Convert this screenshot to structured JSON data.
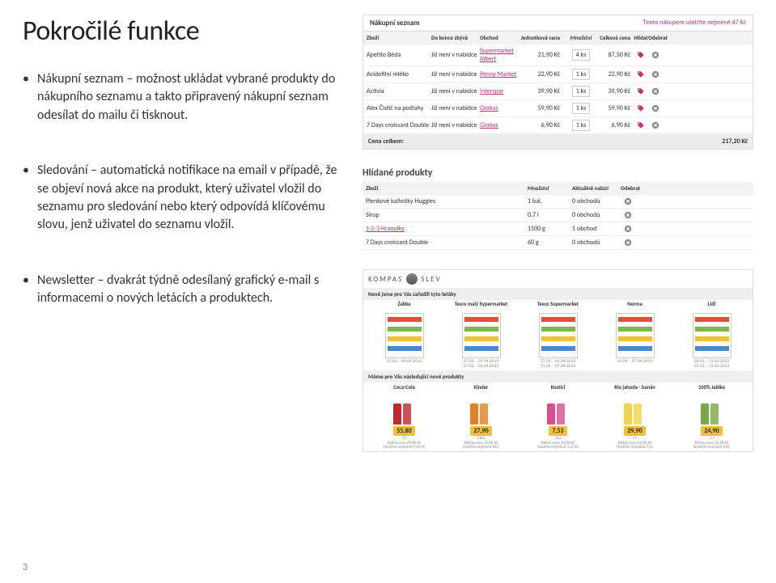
{
  "title": "Pokročilé funkce",
  "page_number": "3",
  "bullets": {
    "b1": "Nákupní seznam – možnost ukládat vybrané produkty do nákupního seznamu a takto připravený nákupní seznam odesílat do mailu či tisknout.",
    "b2": "Sledování – automatická notifikace na email v případě, že se objeví nová akce na produkt, který uživatel vložil do seznamu pro sledování nebo který odpovídá klíčovému slovu, jenž uživatel do seznamu vložil.",
    "b3": "Newsletter – dvakrát týdně odesílaný grafický e-mail s informacemi o nových letácích a produktech."
  },
  "shopping": {
    "title": "Nákupní seznam",
    "savings": "Tímto nákupem ušetříte nejméně 47 Kč",
    "headers": {
      "prod": "Zboží",
      "exp": "Do konce zbývá",
      "store": "Obchod",
      "unit": "Jednotková cena",
      "qty": "Množství",
      "total": "Celková cena",
      "watch": "Hlídat",
      "del": "Odebrat"
    },
    "rows": [
      {
        "prod": "Apetito Béda",
        "exp": "Již není v nabídce",
        "store": "Supermarket Albert",
        "unit": "21,90 Kč",
        "qty": "4 ks",
        "total": "87,50 Kč"
      },
      {
        "prod": "Acidofilní mléko",
        "exp": "Již není v nabídce",
        "store": "Penny Market",
        "unit": "22,90 Kč",
        "qty": "1 ks",
        "total": "22,90 Kč"
      },
      {
        "prod": "Activia",
        "exp": "Již není v nabídce",
        "store": "Interspar",
        "unit": "39,90 Kč",
        "qty": "1 ks",
        "total": "39,90 Kč"
      },
      {
        "prod": "Alex Čistič na podlahy",
        "exp": "Již není v nabídce",
        "store": "Globus",
        "unit": "59,90 Kč",
        "qty": "1 ks",
        "total": "59,90 Kč"
      },
      {
        "prod": "7 Days croissant Double",
        "exp": "Již není v nabídce",
        "store": "Globus",
        "unit": "6,90 Kč",
        "qty": "1 ks",
        "total": "6,90 Kč"
      }
    ],
    "footer_label": "Cena celkem:",
    "footer_total": "217,20 Kč"
  },
  "watched": {
    "title": "Hlídané produkty",
    "headers": {
      "prod": "Zboží",
      "qty": "Množství",
      "off": "Aktuálně nabízí",
      "del": "Odebrat"
    },
    "rows": [
      {
        "prod": "Plenkové kalhotky Huggies",
        "link": false,
        "qty": "1 bal.",
        "off": "0 obchodů"
      },
      {
        "prod": "Sirup",
        "link": false,
        "qty": "0,7 l",
        "off": "0 obchodů"
      },
      {
        "prod": "1-2-3 Hranolky",
        "link": true,
        "qty": "1500 g",
        "off": "1 obchod"
      },
      {
        "prod": "7 Days croissant Double",
        "link": false,
        "qty": "60 g",
        "off": "0 obchodů"
      }
    ]
  },
  "newsletter": {
    "logo": "KOMPAS",
    "logo2": "SLEV",
    "bar1": "Nově jsme pro Vás zařadili tyto letáky",
    "flyers": [
      {
        "name": "Žabka",
        "dates": "27.03. - 09.04.2013"
      },
      {
        "name": "Tesco malý hypermarket",
        "dates": "27.03. - 07.04.2013\n27.03. - 02.04.2013"
      },
      {
        "name": "Tesco Supermarket",
        "dates": "27.03. - 02.04.2013\n27.03. - 07.04.2013"
      },
      {
        "name": "Norma",
        "dates": "01.04. - 07.04.2013"
      },
      {
        "name": "Lidl",
        "dates": "28.03. - 31.03.2013\n25.03. - 31.03.2013"
      }
    ],
    "bar2": "Máme pro Vás následující nové produkty",
    "products": [
      {
        "name": "Coca-Cola",
        "price": "55,80",
        "color": "#c1272d",
        "meta": "2 l\nBěžná cena 64,90 Kč\nUšetříte nejméně 9,10 Kč"
      },
      {
        "name": "Kinder",
        "price": "27,90",
        "color": "#e67e22",
        "meta": "1 bal.\nBěžná cena 35,90 Kč\nUšetříte nejméně 8 Kč"
      },
      {
        "name": "Kostíci",
        "price": "7,53",
        "color": "#d94e8f",
        "meta": "1 ks\nBěžná cena 10,90 Kč\nUšetříte nejméně 3,37 Kč"
      },
      {
        "name": "Rio jahoda - banán",
        "price": "29,90",
        "color": "#f3d34a",
        "meta": "1 l\nBěžná cena 36,90 Kč\nUšetříte nejméně 7 Kč"
      },
      {
        "name": "100% Jablko",
        "price": "24,90",
        "color": "#7aa843",
        "meta": "1 l\nBěžná cena 32,90 Kč\nUšetříte nejméně 8 Kč"
      }
    ]
  }
}
